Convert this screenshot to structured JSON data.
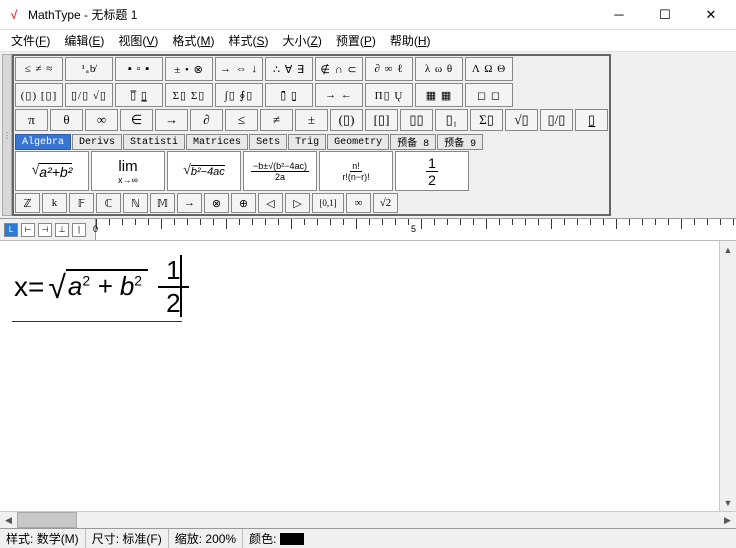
{
  "window": {
    "app": "MathType",
    "doc": "无标题 1",
    "title": "MathType - 无标题 1"
  },
  "menu": [
    {
      "label": "文件",
      "key": "F"
    },
    {
      "label": "编辑",
      "key": "E"
    },
    {
      "label": "视图",
      "key": "V"
    },
    {
      "label": "格式",
      "key": "M"
    },
    {
      "label": "样式",
      "key": "S"
    },
    {
      "label": "大小",
      "key": "Z"
    },
    {
      "label": "预置",
      "key": "P"
    },
    {
      "label": "帮助",
      "key": "H"
    }
  ],
  "symrows": [
    [
      "≤ ≠ ≈",
      "¹ₐb̸",
      "▪ ▫ ▪",
      "± • ⊗",
      "→ ⇔ ↓",
      "∴ ∀ ∃",
      "∉ ∩ ⊂",
      "∂ ∞ ℓ",
      "λ ω θ",
      "Λ Ω Θ"
    ],
    [
      "(▯) [▯]",
      "▯/▯ √▯",
      "▯̅ ▯̲",
      "Σ▯ Σ▯",
      "∫▯ ∮▯",
      "▯̄ ▯̱",
      "→ ←",
      "Π▯ Ų",
      "▦ ▦",
      "◻ ◻"
    ]
  ],
  "tmplrow": [
    "π",
    "θ",
    "∞",
    "∈",
    "→",
    "∂",
    "≤",
    "≠",
    "±",
    "(▯)",
    "[▯]",
    "▯▯",
    "▯₁",
    "Σ▯",
    "√▯",
    "▯/▯",
    "▯̲"
  ],
  "tabs": [
    "Algebra",
    "Derivs",
    "Statisti",
    "Matrices",
    "Sets",
    "Trig",
    "Geometry",
    "预备 8",
    "预备 9"
  ],
  "bigbtns": {
    "pyth": "√(a²+b²)",
    "lim": {
      "top": "lim",
      "bot": "x→∞"
    },
    "disc": "√(b²−4ac)",
    "quad": {
      "num": "−b±√(b²−4ac)",
      "den": "2a"
    },
    "binom": {
      "num": "n!",
      "den": "r!(n−r)!"
    },
    "half": {
      "num": "1",
      "den": "2"
    }
  },
  "smallrow": [
    "ℤ",
    "k",
    "𝔽",
    "ℂ",
    "ℕ",
    "𝕄",
    "→",
    "⊗",
    "⊕",
    "◁",
    "▷",
    "[0,1]",
    "∞",
    "√2"
  ],
  "ruler": {
    "marks": [
      "0",
      "5"
    ]
  },
  "editor": {
    "expression": "x=√(a²+b²) · 1/2",
    "lhs": "x=",
    "radicand": {
      "a": "a",
      "b": "b",
      "sup": "2"
    },
    "frac": {
      "num": "1",
      "den": "2"
    }
  },
  "status": {
    "style_label": "样式:",
    "style_value": "数学(M)",
    "size_label": "尺寸:",
    "size_value": "标准(F)",
    "zoom_label": "缩放:",
    "zoom_value": "200%",
    "color_label": "颜色:",
    "color_value": "#000000"
  }
}
